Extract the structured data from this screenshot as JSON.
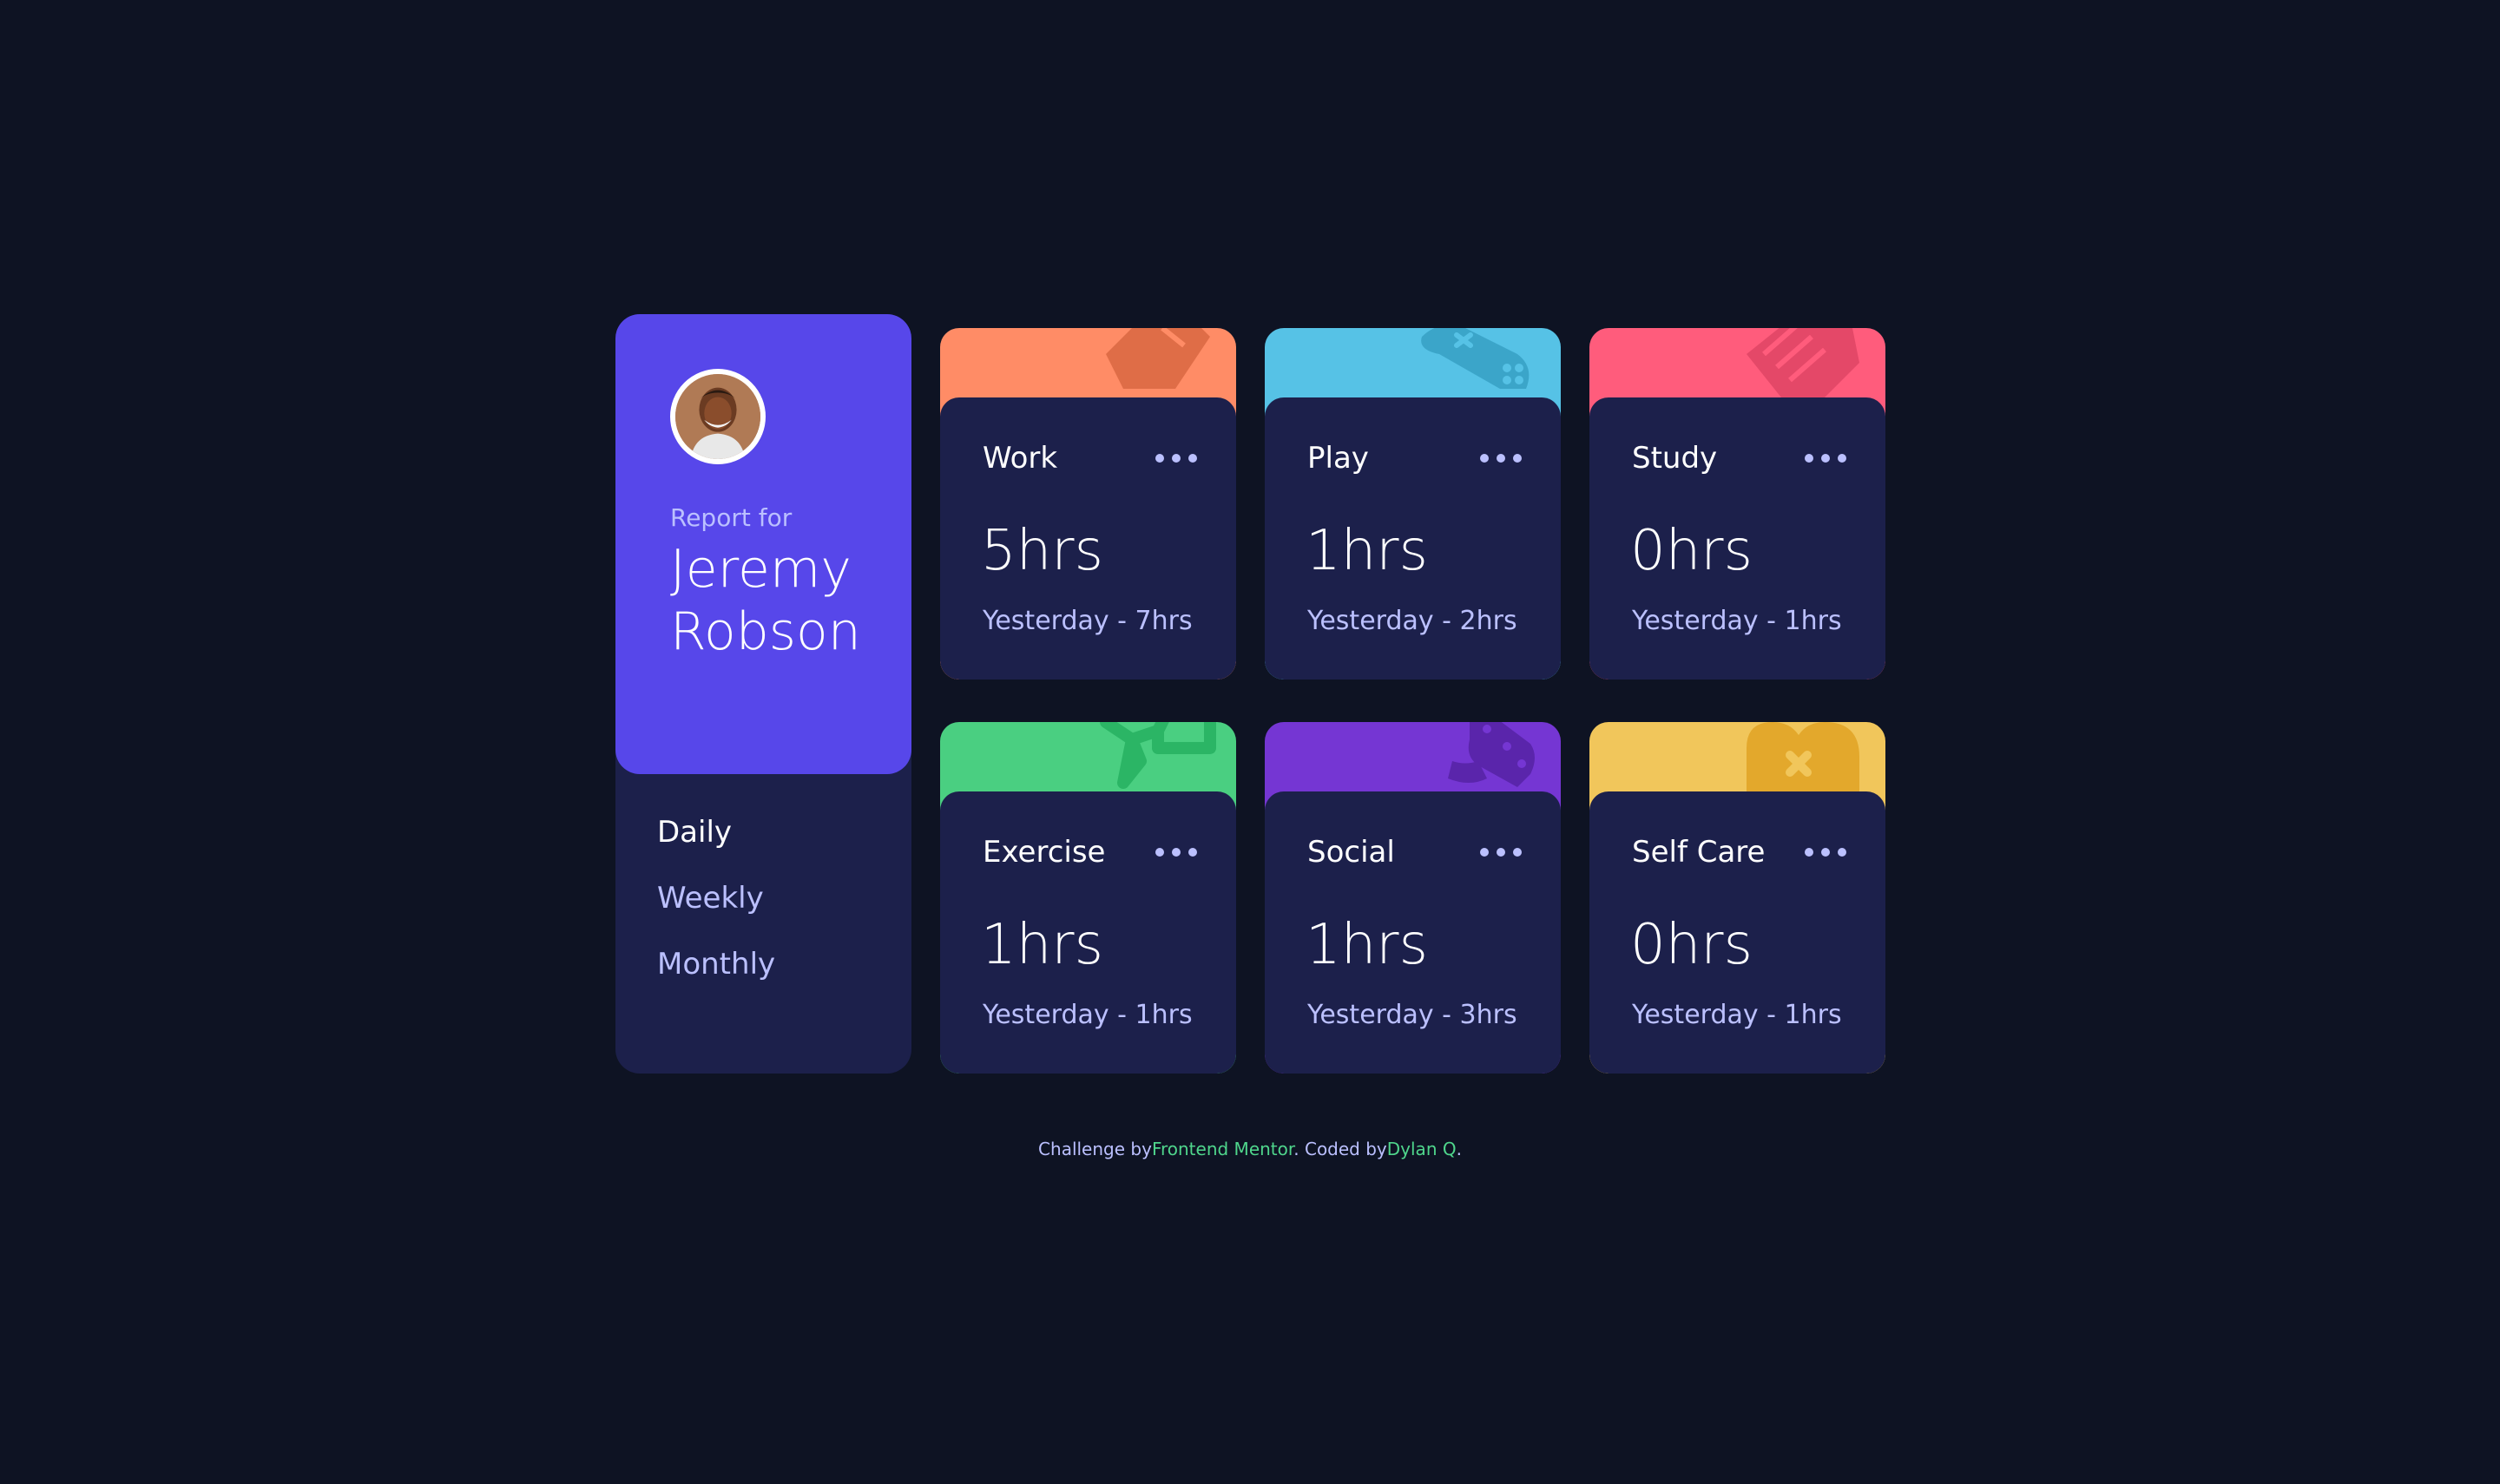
{
  "profile": {
    "report_for": "Report for",
    "name_first": "Jeremy",
    "name_last": "Robson"
  },
  "periods": [
    {
      "label": "Daily",
      "active": true
    },
    {
      "label": "Weekly",
      "active": false
    },
    {
      "label": "Monthly",
      "active": false
    }
  ],
  "activities": [
    {
      "title": "Work",
      "hours": "5hrs",
      "previous": "Yesterday - 7hrs",
      "color": "#ff8c66",
      "icon": "briefcase-icon"
    },
    {
      "title": "Play",
      "hours": "1hrs",
      "previous": "Yesterday - 2hrs",
      "color": "#56c2e6",
      "icon": "gamepad-icon"
    },
    {
      "title": "Study",
      "hours": "0hrs",
      "previous": "Yesterday - 1hrs",
      "color": "#ff5c7c",
      "icon": "book-icon"
    },
    {
      "title": "Exercise",
      "hours": "1hrs",
      "previous": "Yesterday - 1hrs",
      "color": "#4acf81",
      "icon": "running-icon"
    },
    {
      "title": "Social",
      "hours": "1hrs",
      "previous": "Yesterday - 3hrs",
      "color": "#7536d3",
      "icon": "balloon-icon"
    },
    {
      "title": "Self Care",
      "hours": "0hrs",
      "previous": "Yesterday - 1hrs",
      "color": "#f1c65b",
      "icon": "heart-icon"
    }
  ],
  "attribution": {
    "prefix": "Challenge by",
    "challenge_link": "Frontend Mentor",
    "middle": ". Coded by",
    "author_link": "Dylan Q",
    "suffix": "."
  },
  "colors": {
    "background": "#0e1323",
    "card": "#1c204b",
    "profile": "#5747ea",
    "muted": "#bbc0ff",
    "link": "#4fd68c"
  }
}
